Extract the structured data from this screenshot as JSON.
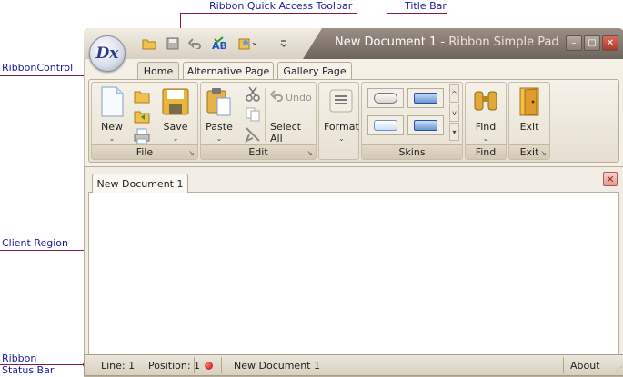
{
  "annotations": {
    "qat": "Ribbon Quick Access Toolbar",
    "title_bar": "Title Bar",
    "ribbon_control": "RibbonControl",
    "client_region": "Client Region",
    "status_bar_line1": "Ribbon",
    "status_bar_line2": "Status Bar"
  },
  "app": {
    "logo": "Dx",
    "document_title": "New Document 1",
    "separator": " - ",
    "app_name": "Ribbon Simple Pad"
  },
  "quick_access": {
    "icons": [
      "open-icon",
      "save-icon",
      "undo-icon",
      "spell-check-icon",
      "paste-options-icon",
      "customize-qat-icon"
    ]
  },
  "window_buttons": {
    "minimize": "–",
    "maximize": "□",
    "close": "✕"
  },
  "ribbon": {
    "tabs": [
      "Home",
      "Alternative Page",
      "Gallery Page"
    ],
    "active_tab": "Home",
    "groups": {
      "file": {
        "label": "File",
        "new_label": "New",
        "save_label": "Save"
      },
      "edit": {
        "label": "Edit",
        "paste_label": "Paste",
        "undo_label": "Undo",
        "select_all_label": "Select All"
      },
      "format": {
        "label": "Format"
      },
      "skins": {
        "label": "Skins"
      },
      "find": {
        "label": "Find",
        "button_label": "Find"
      },
      "exit": {
        "label": "Exit",
        "button_label": "Exit"
      }
    },
    "caret": "⌄"
  },
  "document": {
    "tab_label": "New Document 1",
    "close": "✕"
  },
  "status_bar": {
    "line": "Line: 1",
    "position": "Position: 1",
    "document": "New Document 1",
    "about": "About",
    "status_color": "#d40000"
  },
  "colors": {
    "callout_line": "#8a1840",
    "callout_text": "#1b1b9a",
    "title_bar": "#7a7068",
    "ribbon_bg": "#f5f0e6"
  }
}
